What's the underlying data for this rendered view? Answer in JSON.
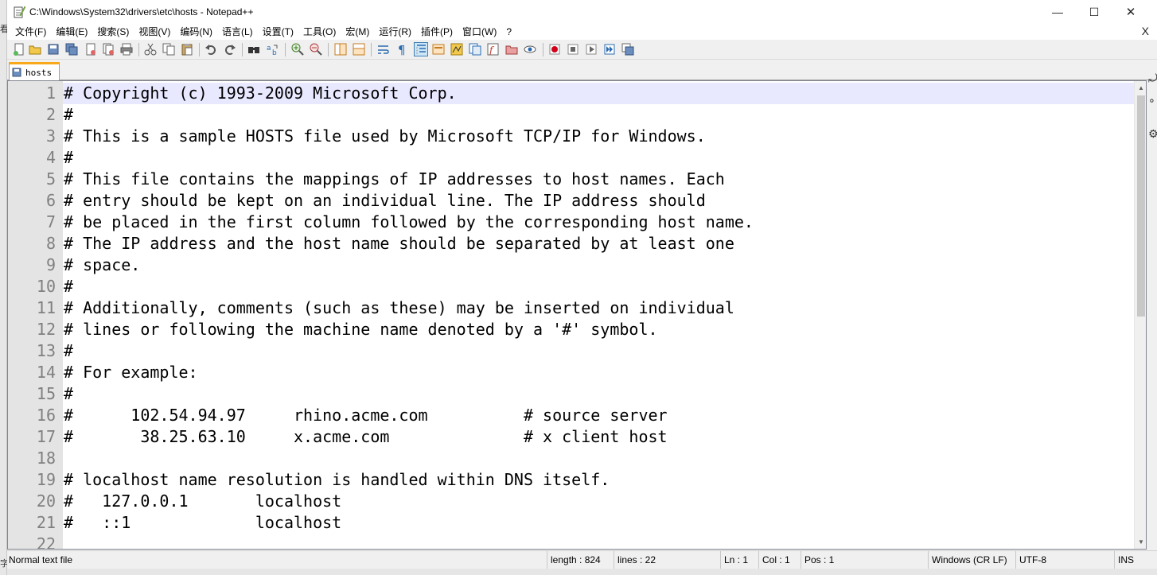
{
  "window": {
    "title": "C:\\Windows\\System32\\drivers\\etc\\hosts - Notepad++",
    "min_glyph": "—",
    "max_glyph": "☐",
    "close_glyph": "✕"
  },
  "menu": {
    "items": [
      "文件(F)",
      "编辑(E)",
      "搜索(S)",
      "视图(V)",
      "编码(N)",
      "语言(L)",
      "设置(T)",
      "工具(O)",
      "宏(M)",
      "运行(R)",
      "插件(P)",
      "窗口(W)",
      "?"
    ],
    "close_glyph": "X"
  },
  "desktop_left": {
    "top_glyph": "看",
    "bottom_glyph": "字"
  },
  "side_tools": [
    "⤾",
    "∘",
    "⚙"
  ],
  "tabs": [
    {
      "label": "hosts"
    }
  ],
  "editor": {
    "current_line": 1,
    "lines": [
      "# Copyright (c) 1993-2009 Microsoft Corp.",
      "#",
      "# This is a sample HOSTS file used by Microsoft TCP/IP for Windows.",
      "#",
      "# This file contains the mappings of IP addresses to host names. Each",
      "# entry should be kept on an individual line. The IP address should",
      "# be placed in the first column followed by the corresponding host name.",
      "# The IP address and the host name should be separated by at least one",
      "# space.",
      "#",
      "# Additionally, comments (such as these) may be inserted on individual",
      "# lines or following the machine name denoted by a '#' symbol.",
      "#",
      "# For example:",
      "#",
      "#      102.54.94.97     rhino.acme.com          # source server",
      "#       38.25.63.10     x.acme.com              # x client host",
      "",
      "# localhost name resolution is handled within DNS itself.",
      "#   127.0.0.1       localhost",
      "#   ::1             localhost",
      ""
    ],
    "line_numbers": [
      "1",
      "2",
      "3",
      "4",
      "5",
      "6",
      "7",
      "8",
      "9",
      "10",
      "11",
      "12",
      "13",
      "14",
      "15",
      "16",
      "17",
      "18",
      "19",
      "20",
      "21",
      "22"
    ]
  },
  "scrollbar": {
    "up_glyph": "▲",
    "down_glyph": "▼"
  },
  "status": {
    "file_type": "Normal text file",
    "length": "length : 824",
    "lines": "lines : 22",
    "ln": "Ln : 1",
    "col": "Col : 1",
    "pos": "Pos : 1",
    "eol": "Windows (CR LF)",
    "encoding": "UTF-8",
    "mode": "INS"
  },
  "colors": {
    "current_line_bg": "#e8e8ff",
    "gutter_bg": "#e4e4e4",
    "line_number_fg": "#808080",
    "tab_accent": "#f7a91b"
  }
}
